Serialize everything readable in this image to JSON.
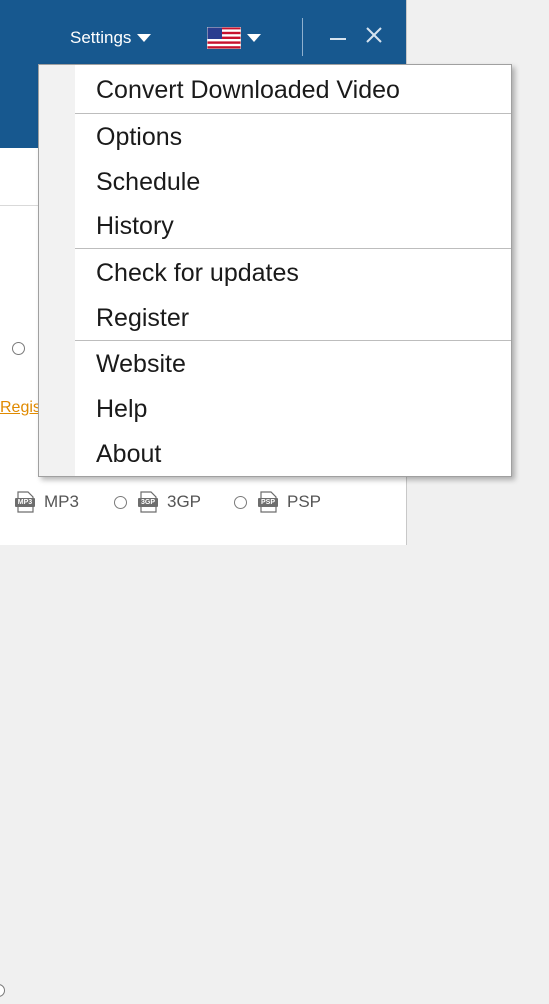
{
  "titlebar": {
    "settings_label": "Settings",
    "language_flag": "us-flag-icon",
    "minimize_icon": "minimize-icon",
    "close_icon": "close-icon",
    "background": "#17588f"
  },
  "content": {
    "register_link_partial": "Regis",
    "formats": [
      {
        "label": "MP3",
        "icon_text": "MP3"
      },
      {
        "label": "3GP",
        "icon_text": "3GP"
      },
      {
        "label": "PSP",
        "icon_text": "PSP"
      }
    ]
  },
  "menu": {
    "items": [
      {
        "label": "Convert Downloaded Video"
      },
      {
        "label": "Options"
      },
      {
        "label": "Schedule"
      },
      {
        "label": "History"
      },
      {
        "label": "Check for updates"
      },
      {
        "label": "Register"
      },
      {
        "label": "Website"
      },
      {
        "label": "Help"
      },
      {
        "label": "About"
      }
    ]
  }
}
